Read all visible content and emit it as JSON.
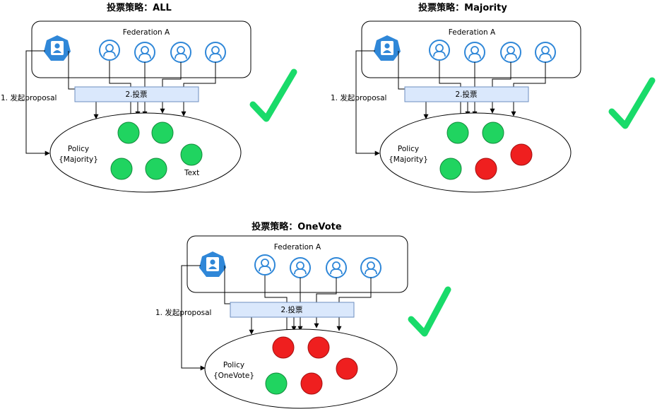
{
  "colors": {
    "accent_blue": "#2f87d8",
    "vote_box_fill": "#dae8fc",
    "vote_box_stroke": "#6c8ebf",
    "agree_green": "#20d460",
    "agree_stroke": "#128a3b",
    "reject_red": "#ef1f1f",
    "reject_stroke": "#a30f0f",
    "check_green": "#19db6a"
  },
  "icons": {
    "admin": "admin-user-badge-icon",
    "member": "member-user-circle-icon",
    "approved": "checkmark-icon"
  },
  "panels": [
    {
      "title": "投票策略：ALL",
      "federation_label": "Federation A",
      "vote_label": "2.投票",
      "proposal_label": "1. 发起proposal",
      "policy_line1": "Policy",
      "policy_line2": "{Majority}",
      "votes": [
        "agree",
        "agree",
        "agree",
        "agree",
        "agree"
      ],
      "extra_text": "Text"
    },
    {
      "title": "投票策略：Majority",
      "federation_label": "Federation A",
      "vote_label": "2.投票",
      "proposal_label": "1. 发起proposal",
      "policy_line1": "Policy",
      "policy_line2": "{Majority}",
      "votes": [
        "agree",
        "agree",
        "reject",
        "agree",
        "reject"
      ],
      "extra_text": ""
    },
    {
      "title": "投票策略：OneVote",
      "federation_label": "Federation A",
      "vote_label": "2.投票",
      "proposal_label": "1. 发起proposal",
      "policy_line1": "Policy",
      "policy_line2": "{OneVote}",
      "votes": [
        "reject",
        "reject",
        "reject",
        "agree",
        "reject"
      ],
      "extra_text": ""
    }
  ]
}
